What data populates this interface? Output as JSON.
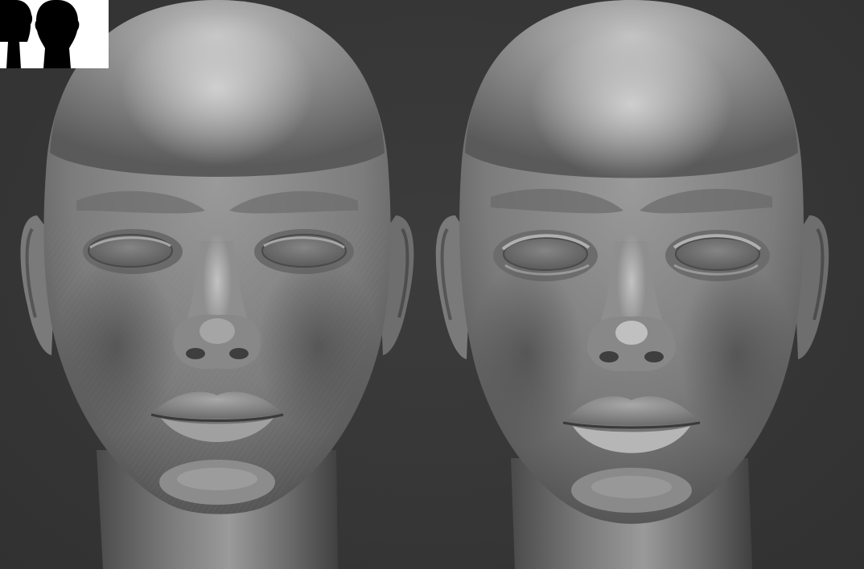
{
  "app": {
    "canvas_background": "#383838",
    "material_color": "#8a8a8a",
    "thumbnail_background": "#ffffff",
    "thumbnail_silhouette": "#000000"
  },
  "viewport": {
    "models": [
      {
        "id": "head-left",
        "state": "sculpt-stroked-surface",
        "view": "front"
      },
      {
        "id": "head-right",
        "state": "smoothed-surface",
        "view": "front"
      }
    ]
  },
  "thumbnail": {
    "icon": "dual-head-silhouette-icon",
    "silhouettes": 2
  }
}
